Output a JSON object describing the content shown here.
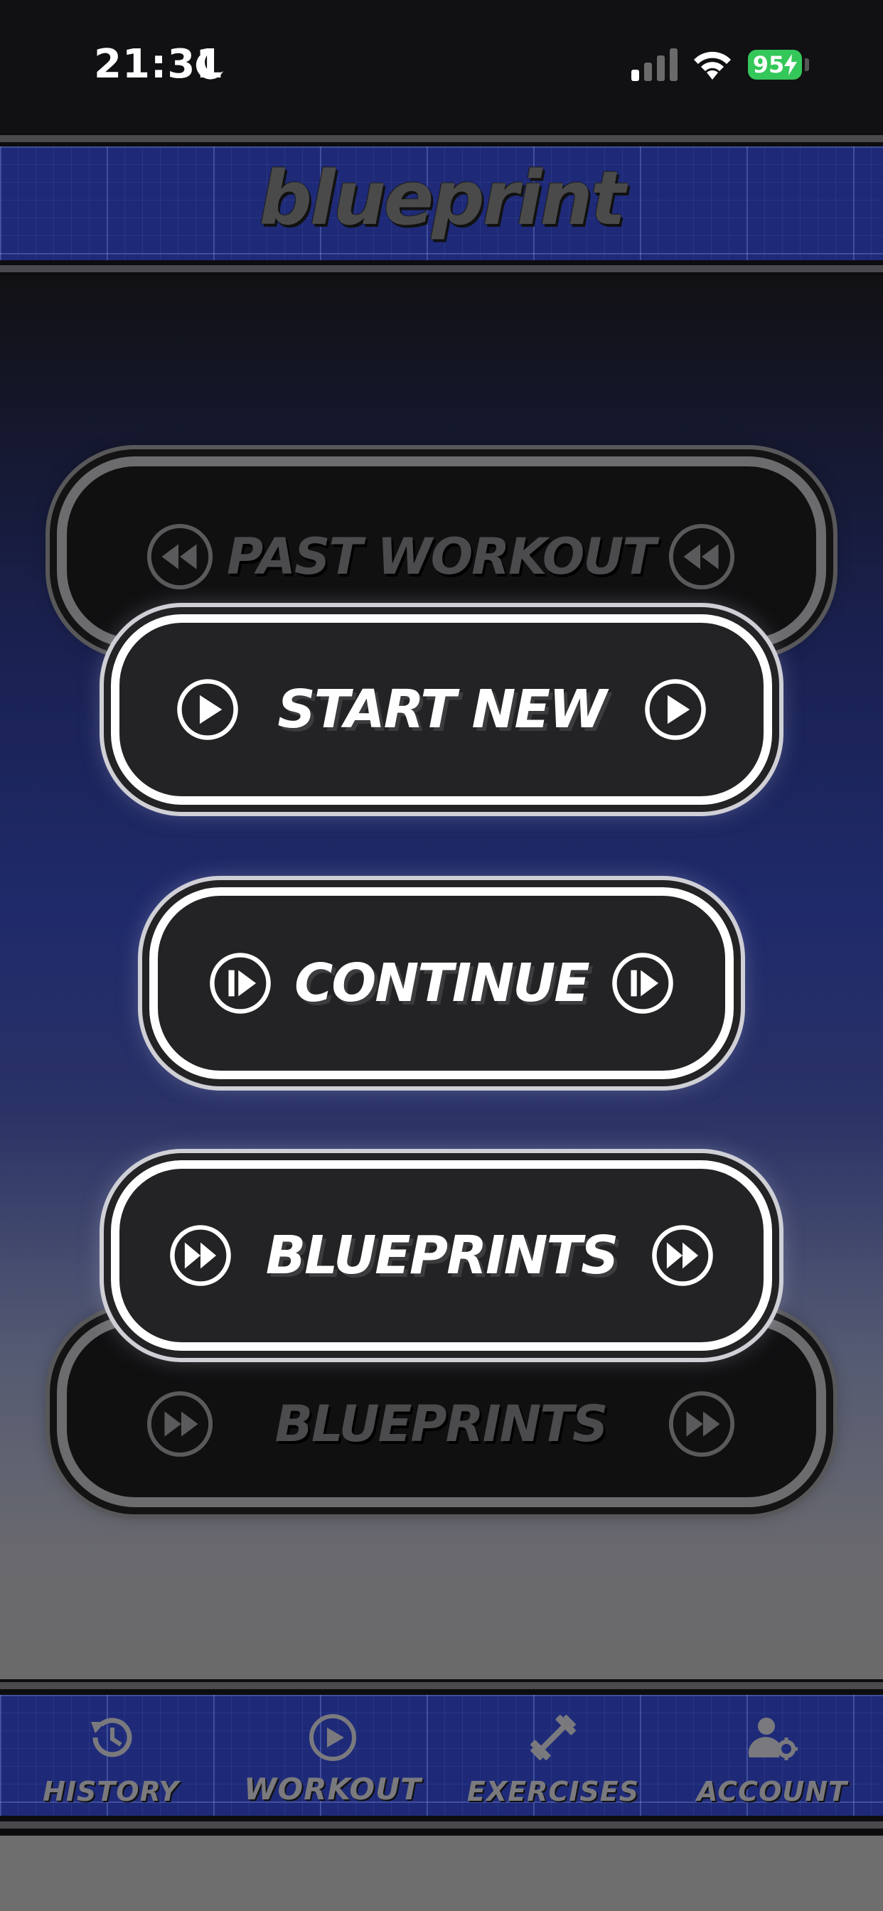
{
  "status_bar": {
    "time": "21:31",
    "battery": "95"
  },
  "header": {
    "logo": "blueprint"
  },
  "buttons": {
    "past_workout": "PAST WORKOUT",
    "start_new": "START NEW",
    "continue": "CONTINUE",
    "blueprints": "BLUEPRINTS",
    "blueprints_shadow": "BLUEPRINTS"
  },
  "nav": {
    "items": [
      {
        "label": "HISTORY",
        "icon": "history-icon"
      },
      {
        "label": "WORKOUT",
        "icon": "play-circle-icon"
      },
      {
        "label": "EXERCISES",
        "icon": "dumbbell-icon"
      },
      {
        "label": "ACCOUNT",
        "icon": "account-settings-icon"
      }
    ]
  },
  "colors": {
    "accent_blue": "#1e2a78",
    "button_fill": "#232325",
    "button_border": "#ffffff",
    "battery_green": "#34c759"
  }
}
